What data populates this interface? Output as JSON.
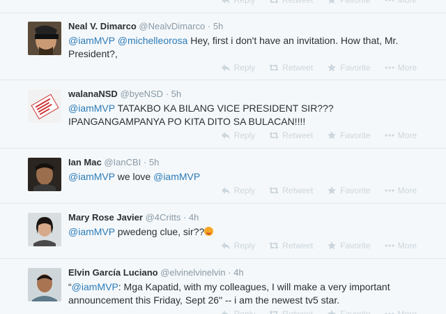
{
  "actions": {
    "reply": "Reply",
    "retweet": "Retweet",
    "favorite": "Favorite",
    "more": "More"
  },
  "tweets": [
    {
      "fullname": "Neal V. Dimarco",
      "username": "@NealvDimarco",
      "time": "5h",
      "mentions": [
        "@iamMVP",
        "@michelleorosa"
      ],
      "text": " Hey, first i don't have an invitation. How that, Mr. President?,"
    },
    {
      "fullname": "walanaNSD",
      "username": "@byeNSD",
      "time": "5h",
      "mentions": [
        "@iamMVP"
      ],
      "text": " TATAKBO KA BILANG VICE PRESIDENT SIR??? IPANGANGAMPANYA PO KITA DITO SA BULACAN!!!!"
    },
    {
      "fullname": "Ian Mac",
      "username": "@IanCBI",
      "time": "5h",
      "mentions": [
        "@iamMVP",
        "@iamMVP"
      ],
      "text_mid": " we love "
    },
    {
      "fullname": "Mary Rose Javier",
      "username": "@4Critts",
      "time": "4h",
      "mentions": [
        "@iamMVP"
      ],
      "text": " pwedeng clue, sir??"
    },
    {
      "fullname": "Elvin García Luciano",
      "username": "@elvinelvinelvin",
      "time": "4h",
      "mentions": [
        "@iamMVP"
      ],
      "quote_open": "“",
      "text": ": Mga Kapatid, with my colleagues, I will make a very important announcement this Friday, Sept 26\" -- i am the newest tv5 star."
    }
  ]
}
